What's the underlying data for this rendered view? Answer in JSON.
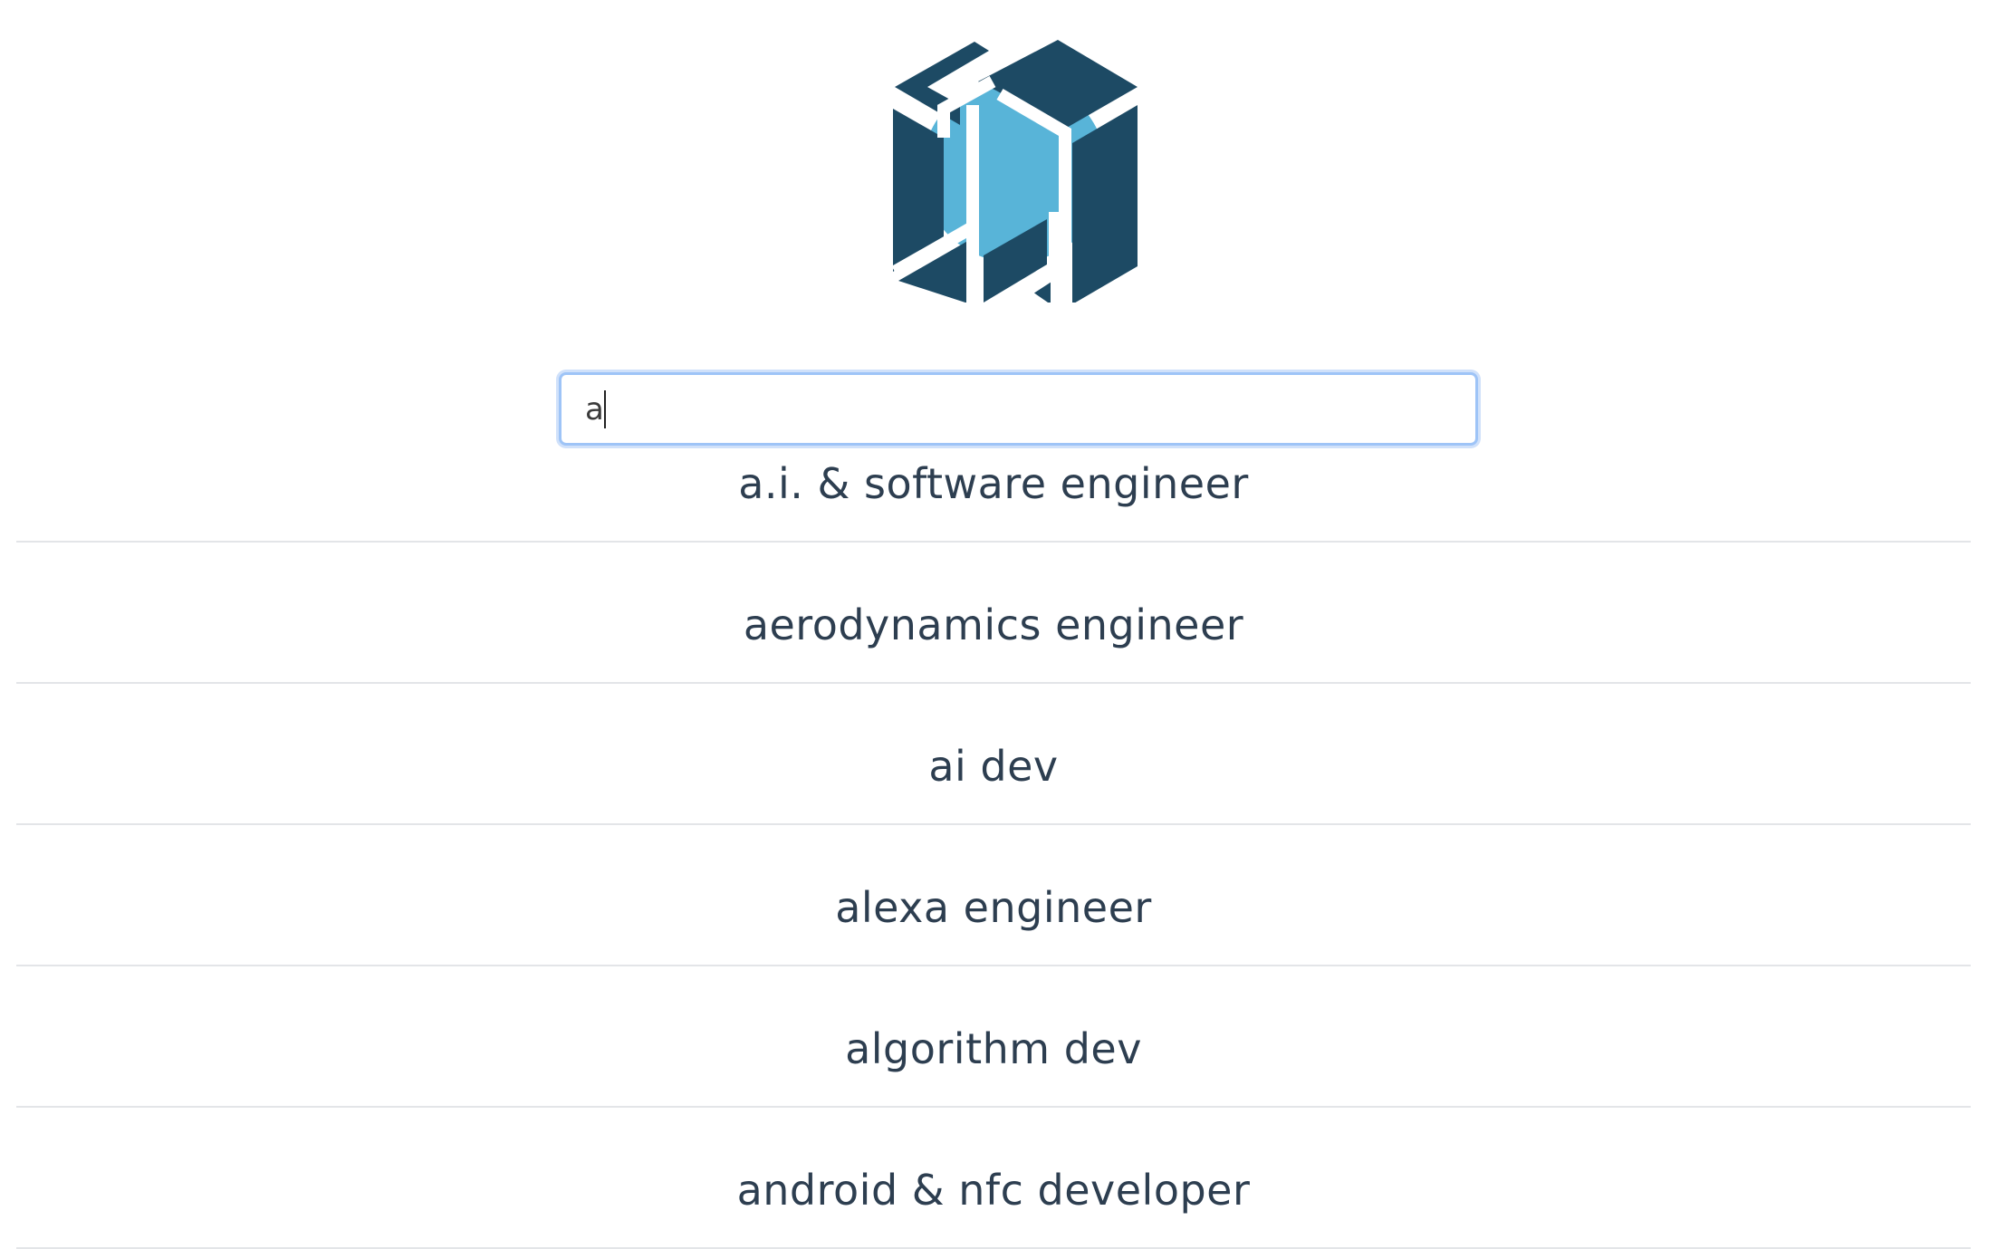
{
  "logo": {
    "icon": "hexagon-cube-logo-icon",
    "colors": {
      "dark": "#1d4a64",
      "light": "#58b4d8"
    }
  },
  "search": {
    "value": "a",
    "placeholder": ""
  },
  "results": [
    {
      "label": "a.i. & software engineer"
    },
    {
      "label": "aerodynamics engineer"
    },
    {
      "label": "ai dev"
    },
    {
      "label": "alexa engineer"
    },
    {
      "label": "algorithm dev"
    },
    {
      "label": "android & nfc developer"
    }
  ]
}
